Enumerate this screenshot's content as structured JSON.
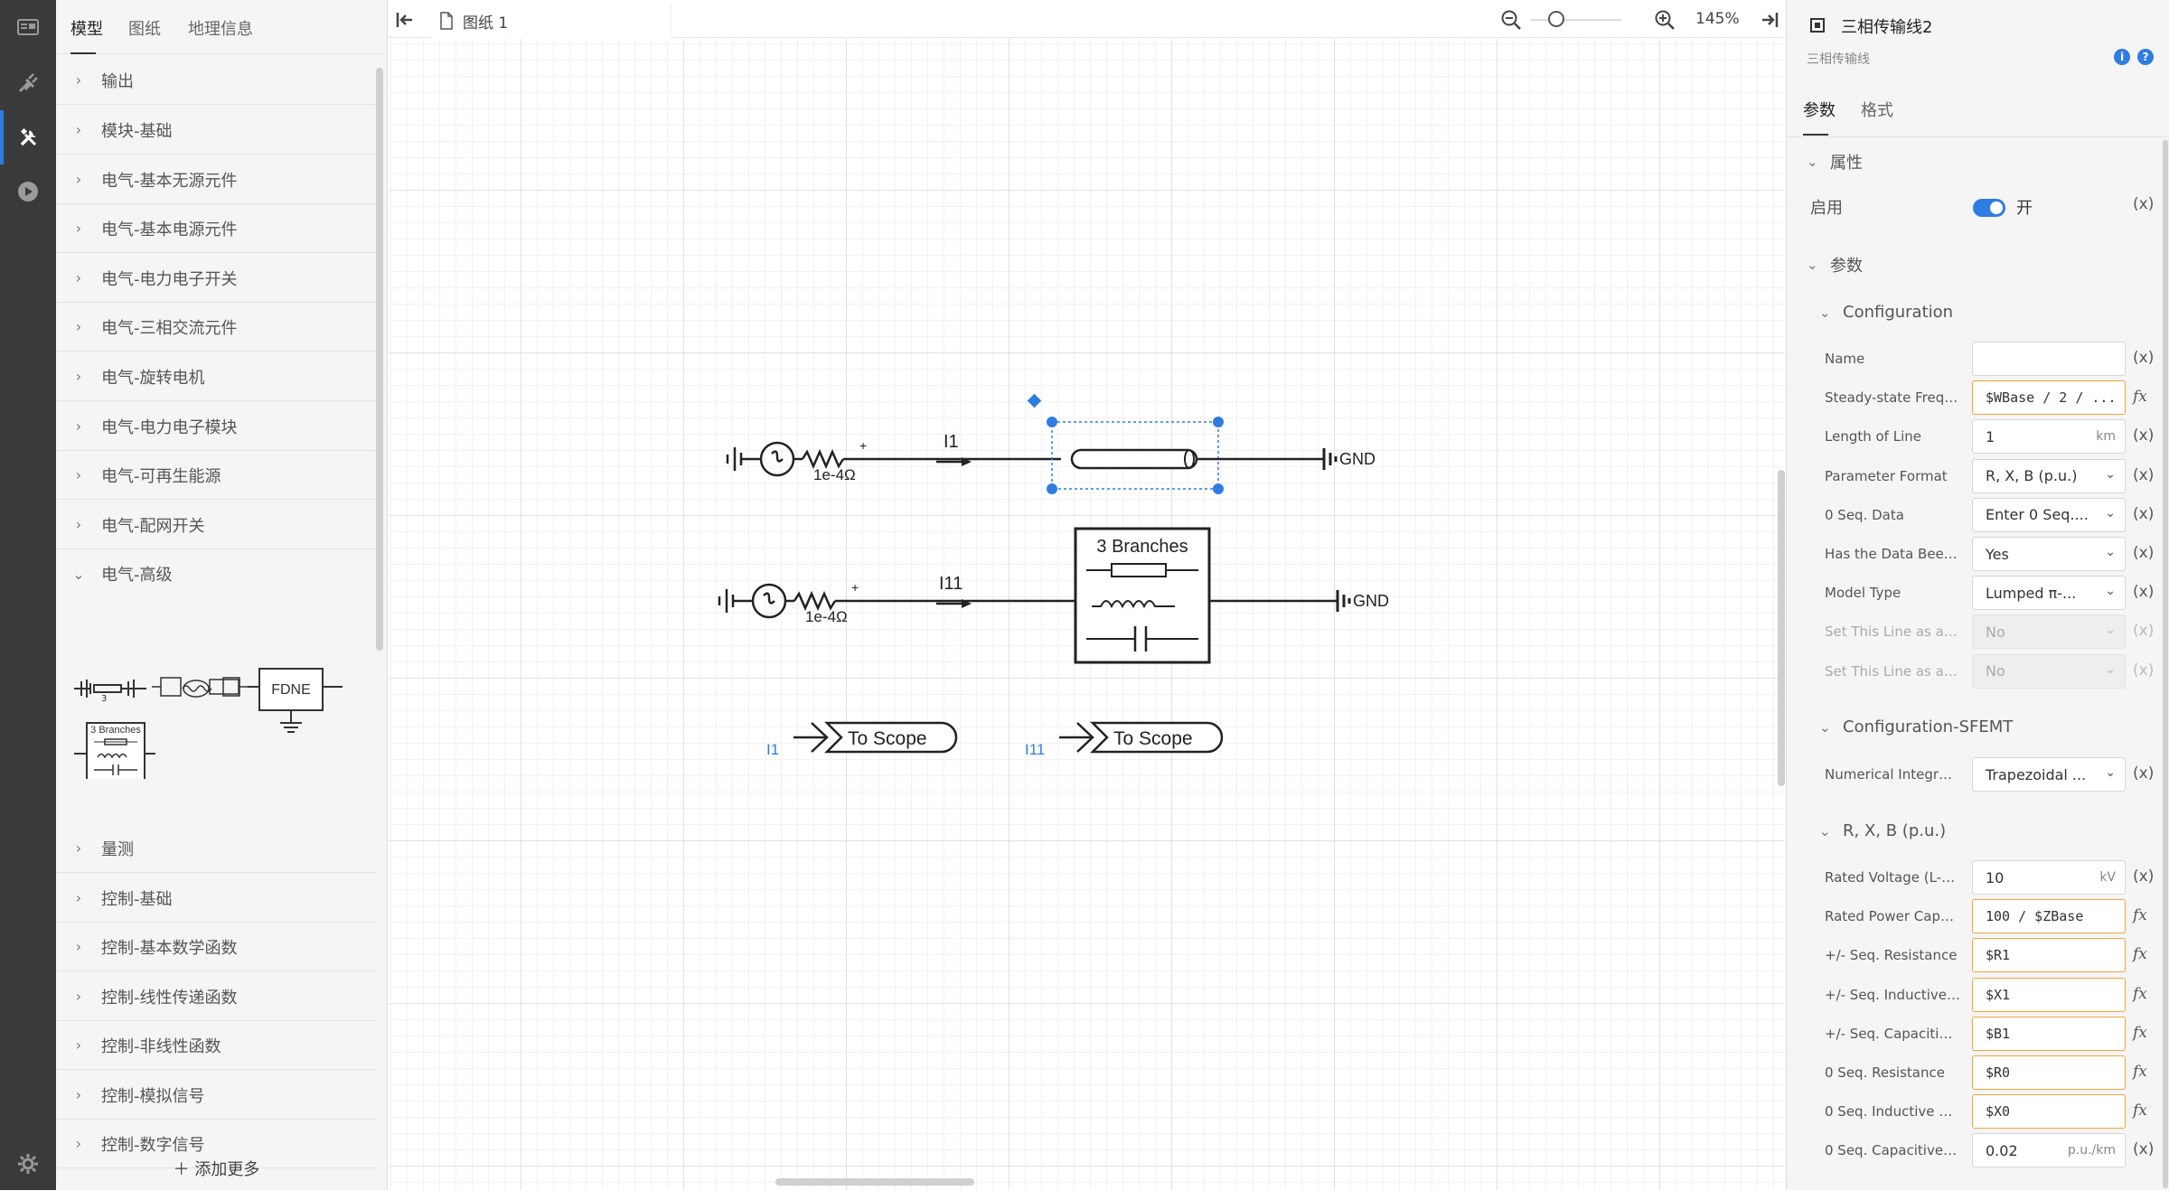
{
  "left_panel": {
    "tabs": [
      "模型",
      "图纸",
      "地理信息"
    ],
    "categories": [
      "输出",
      "模块-基础",
      "电气-基本无源元件",
      "电气-基本电源元件",
      "电气-电力电子开关",
      "电气-三相交流元件",
      "电气-旋转电机",
      "电气-电力电子模块",
      "电气-可再生能源",
      "电气-配网开关",
      "电气-高级",
      "量测",
      "控制-基础",
      "控制-基本数学函数",
      "控制-线性传递函数",
      "控制-非线性函数",
      "控制-模拟信号",
      "控制-数字信号"
    ],
    "expanded_category": "电气-高级",
    "palette": {
      "fdne_label": "FDNE",
      "branches_label": "3 Branches",
      "line_count_label": "3"
    },
    "add_more": "添加更多"
  },
  "toolbar": {
    "doc_tab": "图纸 1",
    "zoom": "145%"
  },
  "diagram": {
    "row1": {
      "resistor": "1e-4Ω",
      "current": "I1",
      "ground": "GND"
    },
    "row2": {
      "resistor": "1e-4Ω",
      "current": "I11",
      "block": "3 Branches",
      "ground": "GND"
    },
    "scopes": [
      {
        "signal": "I1",
        "label": "To Scope"
      },
      {
        "signal": "I11",
        "label": "To Scope"
      }
    ],
    "plus_sign": "+"
  },
  "right_panel": {
    "title": "三相传输线2",
    "subtitle": "三相传输线",
    "tabs": [
      "参数",
      "格式"
    ],
    "sections": {
      "attributes": "属性",
      "params": "参数",
      "config": "Configuration",
      "config_sfemt": "Configuration-SFEMT",
      "rxb": "R, X, B (p.u.)"
    },
    "enable_label": "启用",
    "enable_state": "开",
    "var_marker": "(x)",
    "fx_marker": "fx",
    "config_rows": [
      {
        "label": "Name",
        "value": "",
        "kind": "text",
        "side": "(x)"
      },
      {
        "label": "Steady-state Frequ...",
        "value": "$WBase / 2 / ...",
        "kind": "expr",
        "side": "fx"
      },
      {
        "label": "Length of Line",
        "value": "1",
        "unit": "km",
        "kind": "text",
        "side": "(x)"
      },
      {
        "label": "Parameter Format",
        "value": "R, X, B (p.u.)",
        "kind": "select",
        "side": "(x)"
      },
      {
        "label": "0 Seq. Data",
        "value": "Enter 0 Seq....",
        "kind": "select",
        "side": "(x)"
      },
      {
        "label": "Has the Data Been ...",
        "value": "Yes",
        "kind": "select",
        "side": "(x)"
      },
      {
        "label": "Model Type",
        "value": "Lumped π-...",
        "kind": "select",
        "side": "(x)"
      },
      {
        "label": "Set This Line as a ...",
        "value": "No",
        "kind": "select-disabled",
        "side": "(x)"
      },
      {
        "label": "Set This Line as a ...",
        "value": "No",
        "kind": "select-disabled",
        "side": "(x)"
      }
    ],
    "sfemt_rows": [
      {
        "label": "Numerical Integrati...",
        "value": "Trapezoidal ...",
        "kind": "select",
        "side": "(x)"
      }
    ],
    "rxb_rows": [
      {
        "label": "Rated Voltage (L-L, ...",
        "value": "10",
        "unit": "kV",
        "kind": "text",
        "side": "(x)"
      },
      {
        "label": "Rated Power Capac...",
        "value": "100 / $ZBase",
        "kind": "expr",
        "side": "fx"
      },
      {
        "label": "+/- Seq. Resistance",
        "value": "$R1",
        "kind": "expr",
        "side": "fx"
      },
      {
        "label": "+/- Seq. Inductive R...",
        "value": "$X1",
        "kind": "expr",
        "side": "fx"
      },
      {
        "label": "+/- Seq. Capacitive ...",
        "value": "$B1",
        "kind": "expr",
        "side": "fx"
      },
      {
        "label": "0 Seq. Resistance",
        "value": "$R0",
        "kind": "expr",
        "side": "fx"
      },
      {
        "label": "0 Seq. Inductive Re...",
        "value": "$X0",
        "kind": "expr",
        "side": "fx"
      },
      {
        "label": "0 Seq. Capacitive S...",
        "value": "0.02",
        "unit": "p.u./km",
        "kind": "text",
        "side": "(x)"
      }
    ]
  },
  "colors": {
    "accent": "#2f7de1",
    "expr_border": "#f0a53b",
    "selection": "#2f7de1",
    "signal_label": "#2f7de1"
  }
}
